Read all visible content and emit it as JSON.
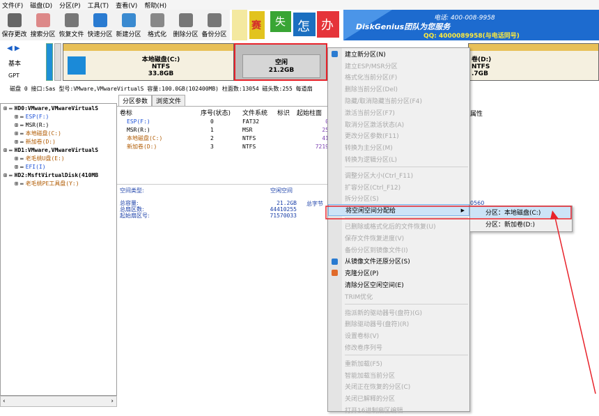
{
  "menubar": [
    "文件(F)",
    "磁盘(D)",
    "分区(P)",
    "工具(T)",
    "查看(V)",
    "帮助(H)"
  ],
  "toolbar": [
    {
      "label": "保存更改",
      "icon": "save-icon",
      "color": "#666"
    },
    {
      "label": "搜索分区",
      "icon": "search-icon",
      "color": "#d88"
    },
    {
      "label": "恢复文件",
      "icon": "recover-icon",
      "color": "#777"
    },
    {
      "label": "快速分区",
      "icon": "quick-partition-icon",
      "color": "#2a7bd1"
    },
    {
      "label": "新建分区",
      "icon": "new-partition-icon",
      "color": "#3a8ad0"
    },
    {
      "label": "格式化",
      "icon": "format-icon",
      "color": "#888"
    },
    {
      "label": "删除分区",
      "icon": "delete-icon",
      "color": "#777"
    },
    {
      "label": "备份分区",
      "icon": "backup-icon",
      "color": "#777"
    }
  ],
  "banner": {
    "chars": [
      "赛",
      "失",
      "怎",
      "办"
    ],
    "team": "DiskGenius团队为您服务",
    "phone": "电话: 400-008-9958",
    "qq": "QQ: 4000089958(与电话同号)"
  },
  "disk_map": {
    "left_labels": [
      "基本",
      "GPT"
    ],
    "partitions": [
      {
        "name": "本地磁盘(C:)",
        "fs": "NTFS",
        "size": "33.8GB"
      },
      {
        "name": "空闲",
        "size": "21.2GB"
      },
      {
        "name": "卷(D:)",
        "fs": "NTFS",
        "size": ".7GB"
      }
    ]
  },
  "infobar": "磁盘 0 接口:Sas  型号:VMware,VMwareVirtualS  容量:100.0GB(102400MB)  柱面数:13054  磁头数:255  每道扇",
  "tree": [
    {
      "text": "HD0:VMware,VMwareVirtualS",
      "indent": 0,
      "color": "#000",
      "bold": true
    },
    {
      "text": "ESP(F:)",
      "indent": 1,
      "color": "#1a4fd6"
    },
    {
      "text": "MSR(R:)",
      "indent": 1,
      "color": "#000"
    },
    {
      "text": "本地磁盘(C:)",
      "indent": 1,
      "color": "#b05a00"
    },
    {
      "text": "新加卷(D:)",
      "indent": 1,
      "color": "#b05a00"
    },
    {
      "text": "HD1:VMware,VMwareVirtualS",
      "indent": 0,
      "color": "#000",
      "bold": true
    },
    {
      "text": "老毛桃U盘(E:)",
      "indent": 1,
      "color": "#b05a00"
    },
    {
      "text": "EFI(I)",
      "indent": 1,
      "color": "#1a4fd6"
    },
    {
      "text": "HD2:MsftVirtualDisk(410MB",
      "indent": 0,
      "color": "#000",
      "bold": true
    },
    {
      "text": "老毛桃PE工具盘(Y:)",
      "indent": 1,
      "color": "#b05a00"
    }
  ],
  "tabs": [
    "分区参数",
    "浏览文件"
  ],
  "table": {
    "headers": [
      "卷标",
      "序号(状态)",
      "文件系统",
      "标识",
      "起始柱面"
    ],
    "rows": [
      {
        "name": "ESP(F:)",
        "idx": "0",
        "fs": "FAT32",
        "start": "0",
        "color": "#1a4fd6"
      },
      {
        "name": "MSR(R:)",
        "idx": "1",
        "fs": "MSR",
        "start": "25",
        "color": "#000"
      },
      {
        "name": "本地磁盘(C:)",
        "idx": "2",
        "fs": "NTFS",
        "start": "41",
        "color": "#b05a00"
      },
      {
        "name": "新加卷(D:)",
        "idx": "3",
        "fs": "NTFS",
        "start": "7219",
        "color": "#b05a00"
      }
    ],
    "extra_header": "属性"
  },
  "details": {
    "type_label": "空间类型:",
    "type_value": "空闲空间",
    "total_label": "总容量:",
    "total_value": "21.2GB",
    "total_bytes_label": "总字节",
    "sectors_label": "总扇区数:",
    "sectors_value": "44410255",
    "start_label": "起始扇区号:",
    "start_value": "71570033",
    "right_value": "0560"
  },
  "context_menu": [
    {
      "label": "建立新分区(N)",
      "enabled": true,
      "icon": "new-partition-icon",
      "color": "#2a7bd1"
    },
    {
      "label": "建立ESP/MSR分区",
      "enabled": false
    },
    {
      "label": "格式化当前分区(F)",
      "enabled": false
    },
    {
      "label": "删除当前分区(Del)",
      "enabled": false
    },
    {
      "label": "隐藏/取消隐藏当前分区(F4)",
      "enabled": false
    },
    {
      "label": "激活当前分区(F7)",
      "enabled": false
    },
    {
      "label": "取消分区激活状态(A)",
      "enabled": false
    },
    {
      "label": "更改分区参数(F11)",
      "enabled": false
    },
    {
      "label": "转换为主分区(M)",
      "enabled": false
    },
    {
      "label": "转换为逻辑分区(L)",
      "enabled": false
    },
    {
      "sep": true
    },
    {
      "label": "调整分区大小(Ctrl_F11)",
      "enabled": false
    },
    {
      "label": "扩容分区(Ctrl_F12)",
      "enabled": false
    },
    {
      "label": "拆分分区(S)",
      "enabled": false
    },
    {
      "label": "将空闲空间分配给",
      "enabled": true,
      "highlight": true,
      "submenu": true
    },
    {
      "sep": true
    },
    {
      "label": "已删除或格式化后的文件恢复(U)",
      "enabled": false
    },
    {
      "label": "保存文件恢复进度(V)",
      "enabled": false
    },
    {
      "label": "备份分区到镜像文件(I)",
      "enabled": false
    },
    {
      "label": "从镜像文件还原分区(S)",
      "enabled": true,
      "icon": "restore-icon",
      "color": "#2a7bd1"
    },
    {
      "label": "克隆分区(P)",
      "enabled": true,
      "icon": "clone-icon",
      "color": "#e06a2a"
    },
    {
      "label": "清除分区空闲空间(E)",
      "enabled": true
    },
    {
      "label": "TRIM优化",
      "enabled": false
    },
    {
      "sep": true
    },
    {
      "label": "指派新的驱动器号(盘符)(G)",
      "enabled": false
    },
    {
      "label": "删除驱动器号(盘符)(R)",
      "enabled": false
    },
    {
      "label": "设置卷标(V)",
      "enabled": false
    },
    {
      "label": "修改卷序列号",
      "enabled": false
    },
    {
      "sep": true
    },
    {
      "label": "重新加载(F5)",
      "enabled": false
    },
    {
      "label": "智能加载当前分区",
      "enabled": false
    },
    {
      "label": "关闭正在恢复的分区(C)",
      "enabled": false
    },
    {
      "label": "关闭已解释的分区",
      "enabled": false
    },
    {
      "label": "打开16进制扇区编辑",
      "enabled": false
    }
  ],
  "submenu": [
    "分区：本地磁盘(C:)",
    "分区：新加卷(D:)"
  ],
  "annotation_color": "#e8222a"
}
